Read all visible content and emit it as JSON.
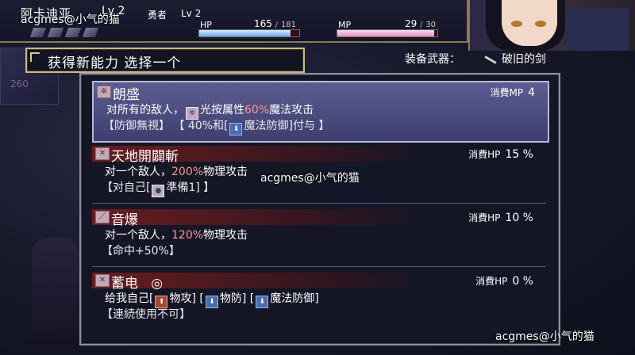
{
  "status": {
    "char_name": "阿卡迪亚",
    "level_text": "Lv 2",
    "class_name": "勇者",
    "class_level": "Lv 2",
    "hp": {
      "label": "HP",
      "current": "165",
      "max": "181",
      "fraction": 0.91
    },
    "mp": {
      "label": "MP",
      "current": "29",
      "max": "30",
      "fraction": 0.97
    },
    "slash": "/"
  },
  "header": {
    "title": "获得新能力 选择一个"
  },
  "equipment": {
    "label": "装备武器：",
    "weapon": "破旧的剑"
  },
  "background": {
    "book_number": "260"
  },
  "skills": [
    {
      "name": "朗盛",
      "cost_label": "消費MP",
      "cost_value": "4",
      "desc_a": "对所有的敌人，",
      "desc_b": "光按属性",
      "desc_pct": "60%",
      "desc_c": "魔法攻击",
      "note_a": "【防御無視】 【 40%和[",
      "note_b": "魔法防御]付与 】"
    },
    {
      "name": "天地開闢斬",
      "cost_label": "消費HP",
      "cost_value": "15 %",
      "desc_a": "对一个敌人，",
      "desc_pct": "200%",
      "desc_c": "物理攻击",
      "note_a": "【对自己[",
      "note_b": "準備1] 】"
    },
    {
      "name": "音爆",
      "cost_label": "消費HP",
      "cost_value": "10 %",
      "desc_a": "对一个敌人，",
      "desc_pct": "120%",
      "desc_c": "物理攻击",
      "note_a": "【命中+50%】"
    },
    {
      "name": "蓄电",
      "mark": "◎",
      "cost_label": "消費HP",
      "cost_value": "0 %",
      "desc_a": "给我自己[",
      "desc_b": "物攻] [",
      "desc_c": "物防] [",
      "desc_d": "魔法防御]",
      "note_a": "【連続使用不可】"
    }
  ],
  "watermark": "acgmes@小气的猫"
}
